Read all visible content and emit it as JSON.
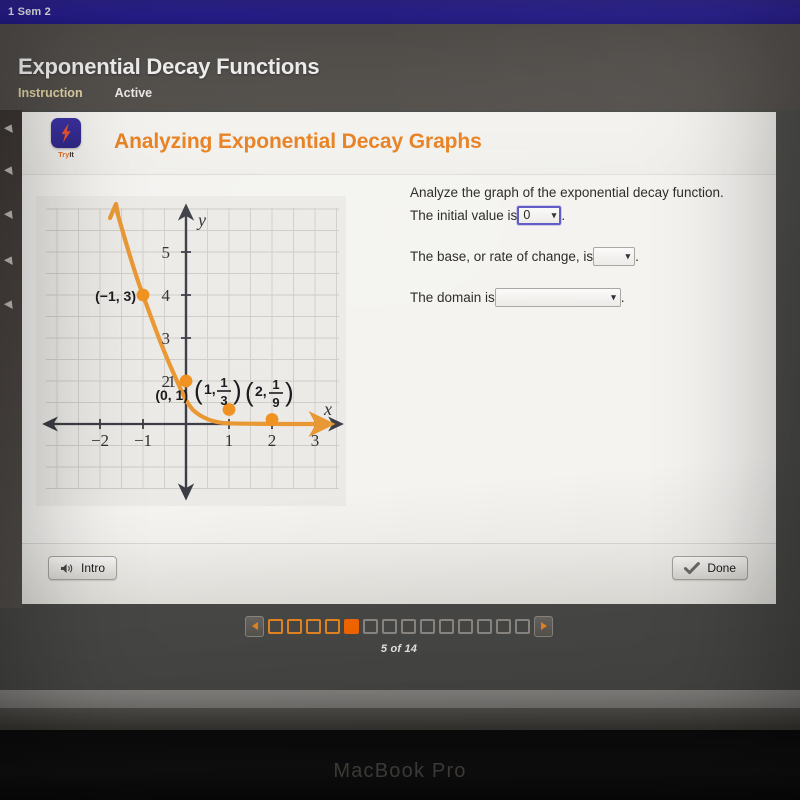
{
  "browser": {
    "tab_title": "1 Sem 2"
  },
  "header": {
    "lesson_title": "Exponential Decay Functions",
    "tabs": [
      {
        "label": "Instruction",
        "state": "active"
      },
      {
        "label": "Active",
        "state": "normal"
      }
    ]
  },
  "card": {
    "try_it": {
      "label_try": "Try",
      "label_it": "It",
      "icon": "lightning-bolt-icon"
    },
    "title": "Analyzing Exponential Decay Graphs"
  },
  "question": {
    "prompt": "Analyze the graph of the exponential decay function.",
    "line1_pre": "The initial value is",
    "line1_post": ".",
    "initial_value_selected": "0",
    "line2_pre": "The base, or rate of change, is",
    "line2_post": ".",
    "base_selected": "",
    "line3_pre": "The domain is",
    "line3_post": ".",
    "domain_selected": "",
    "chevron": "⌄"
  },
  "footer": {
    "intro_label": "Intro",
    "intro_icon": "speaker-icon",
    "done_label": "Done",
    "done_icon": "checkmark-icon"
  },
  "pager": {
    "prev_icon": "triangle-left-icon",
    "next_icon": "triangle-right-icon",
    "total": 14,
    "current": 5,
    "count_label": "5 of 14",
    "boxes": [
      "visited",
      "visited",
      "visited",
      "visited",
      "current",
      "future",
      "future",
      "future",
      "future",
      "future",
      "future",
      "future",
      "future",
      "future"
    ]
  },
  "device": {
    "brand_label": "MacBook Pro"
  },
  "colors": {
    "accent_orange": "#e8801f",
    "curve_orange": "#e8962f",
    "point_orange": "#f0901c",
    "current_page": "#ff6a00",
    "topbar_blue": "#2a1f9e",
    "header_gray": "#57534f",
    "focus_border": "#5b55c4"
  },
  "chart_data": {
    "type": "line",
    "title": "",
    "function": "y = (1/3)^x",
    "xlabel": "x",
    "ylabel": "y",
    "xlim": [
      -2.8,
      3.8
    ],
    "ylim": [
      -0.9,
      5.6
    ],
    "x_ticks": [
      "-2",
      "-1",
      "1",
      "2",
      "3"
    ],
    "x_tick_values": [
      -2,
      -1,
      1,
      2,
      3
    ],
    "y_ticks": [
      "2",
      "3",
      "4",
      "5"
    ],
    "y_tick_values": [
      2,
      3,
      4,
      5
    ],
    "grid": true,
    "grid_step": 0.5,
    "legend": "none",
    "series": [
      {
        "name": "exponential decay",
        "color": "#e8962f",
        "x": [
          -1.62,
          -1.4,
          -1.2,
          -1.0,
          -0.8,
          -0.6,
          -0.4,
          -0.2,
          0,
          0.25,
          0.5,
          0.75,
          1.0,
          1.5,
          2.0,
          2.5,
          3.0,
          3.5
        ],
        "y": [
          5.55,
          4.66,
          3.74,
          3.0,
          2.41,
          1.93,
          1.55,
          1.25,
          1.0,
          0.76,
          0.577,
          0.439,
          0.333,
          0.192,
          0.111,
          0.064,
          0.037,
          0.021
        ]
      }
    ],
    "points": [
      {
        "label": "(−1, 3)",
        "x": -1,
        "y": 3,
        "label_pos": "left"
      },
      {
        "label": "(0, 1)",
        "x": 0,
        "y": 1,
        "label_pos": "below-left"
      },
      {
        "label": "(1, 1/3)",
        "x": 1,
        "y": 0.3333,
        "label_pos": "above-right",
        "frac_num": "1",
        "frac_den": "3",
        "lead": "1,"
      },
      {
        "label": "(2, 1/9)",
        "x": 2,
        "y": 0.1111,
        "label_pos": "above-right",
        "frac_num": "1",
        "frac_den": "9",
        "lead": "2,"
      }
    ]
  }
}
